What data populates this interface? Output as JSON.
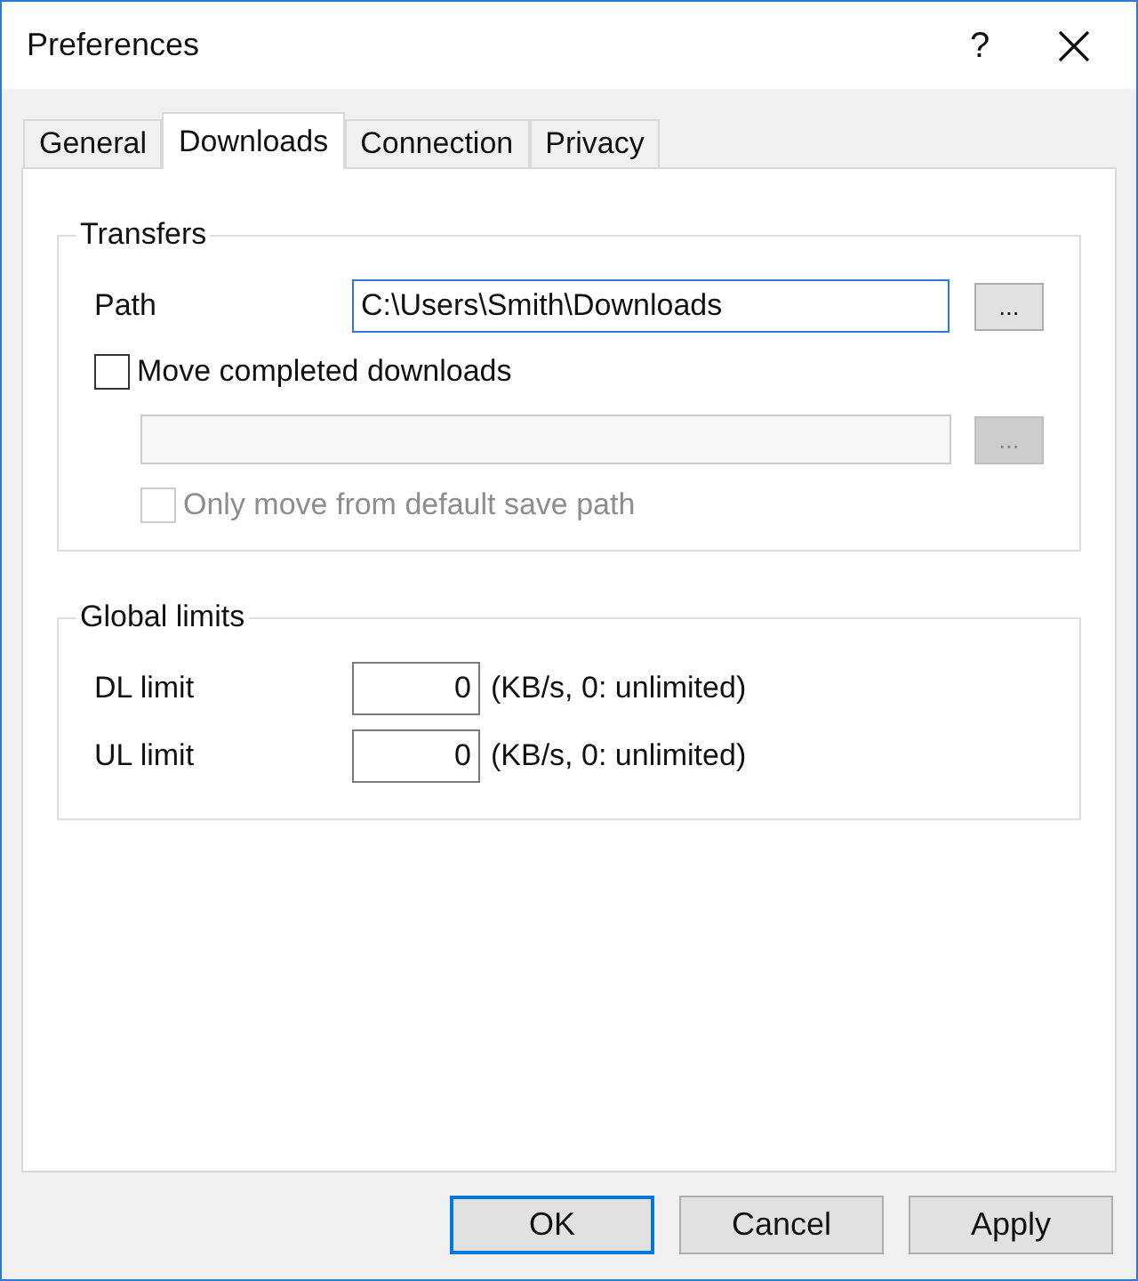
{
  "window": {
    "title": "Preferences",
    "help": "?"
  },
  "tabs": [
    {
      "label": "General",
      "selected": false
    },
    {
      "label": "Downloads",
      "selected": true
    },
    {
      "label": "Connection",
      "selected": false
    },
    {
      "label": "Privacy",
      "selected": false
    }
  ],
  "transfers": {
    "title": "Transfers",
    "path_label": "Path",
    "path_value": "C:\\Users\\Smith\\Downloads",
    "path_browse": "...",
    "move_completed": {
      "label": "Move completed downloads",
      "checked": false
    },
    "move_browse": "...",
    "move_disabled": true,
    "only_default": {
      "label": "Only move from default save path",
      "checked": false,
      "disabled": true
    }
  },
  "global_limits": {
    "title": "Global limits",
    "rows": [
      {
        "label": "DL limit",
        "value": "0",
        "hint": "(KB/s, 0: unlimited)"
      },
      {
        "label": "UL limit",
        "value": "0",
        "hint": "(KB/s, 0: unlimited)"
      }
    ]
  },
  "buttons": [
    {
      "label": "OK",
      "default": true
    },
    {
      "label": "Cancel",
      "default": false
    },
    {
      "label": "Apply",
      "default": false
    }
  ]
}
